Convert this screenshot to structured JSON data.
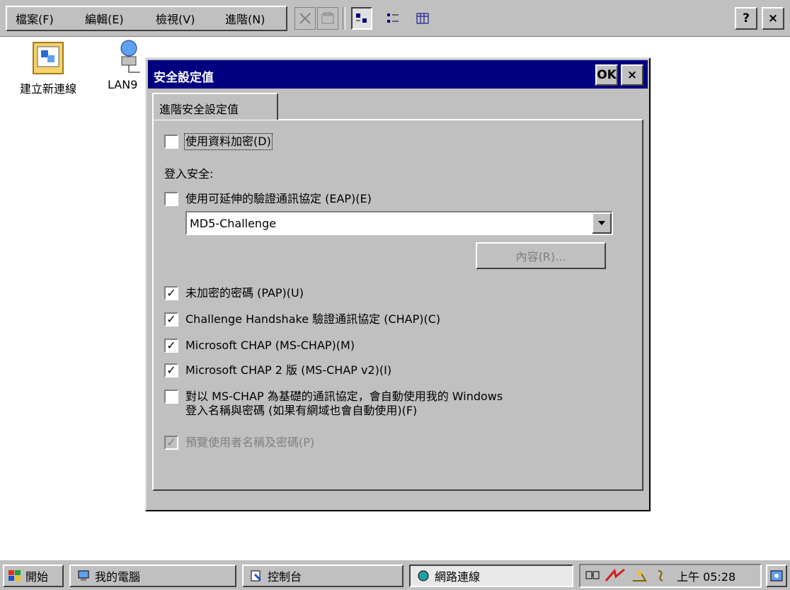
{
  "menubar": {
    "menus": [
      "檔案(F)",
      "編輯(E)",
      "檢視(V)",
      "進階(N)"
    ],
    "help_label": "?",
    "close_label": "×"
  },
  "desktop": {
    "icons": [
      {
        "label": "建立新連線",
        "icon": "new-connection-icon"
      },
      {
        "label": "LAN9",
        "icon": "lan-connection-icon"
      }
    ]
  },
  "dialog": {
    "title": "安全設定值",
    "ok_label": "OK",
    "close_label": "×",
    "tab_label": "進階安全設定值",
    "use_data_encryption": {
      "label": "使用資料加密(D)",
      "checked": false
    },
    "login_security_label": "登入安全:",
    "use_eap": {
      "label": "使用可延伸的驗證通訊協定 (EAP)(E)",
      "checked": false
    },
    "eap_combo": {
      "value": "MD5-Challenge"
    },
    "properties_button": "內容(R)...",
    "pap": {
      "label": "未加密的密碼 (PAP)(U)",
      "checked": true
    },
    "chap": {
      "label": "Challenge Handshake 驗證通訊協定 (CHAP)(C)",
      "checked": true
    },
    "mschap": {
      "label": "Microsoft CHAP (MS-CHAP)(M)",
      "checked": true
    },
    "mschapv2": {
      "label": "Microsoft CHAP 2 版 (MS-CHAP v2)(I)",
      "checked": true
    },
    "auto_windows_login": {
      "label_line1": "對以 MS-CHAP 為基礎的通訊協定，會自動使用我的 Windows",
      "label_line2": "登入名稱與密碼 (如果有網域也會自動使用)(F)",
      "checked": false
    },
    "preview_username_password": {
      "label": "預覽使用者名稱及密碼(P)",
      "checked": true,
      "disabled": true
    }
  },
  "taskbar": {
    "start_label": "開始",
    "tasks": [
      {
        "label": "我的電腦",
        "active": false
      },
      {
        "label": "控制台",
        "active": false
      },
      {
        "label": "網路連線",
        "active": true
      }
    ],
    "clock": "上午 05:28"
  }
}
